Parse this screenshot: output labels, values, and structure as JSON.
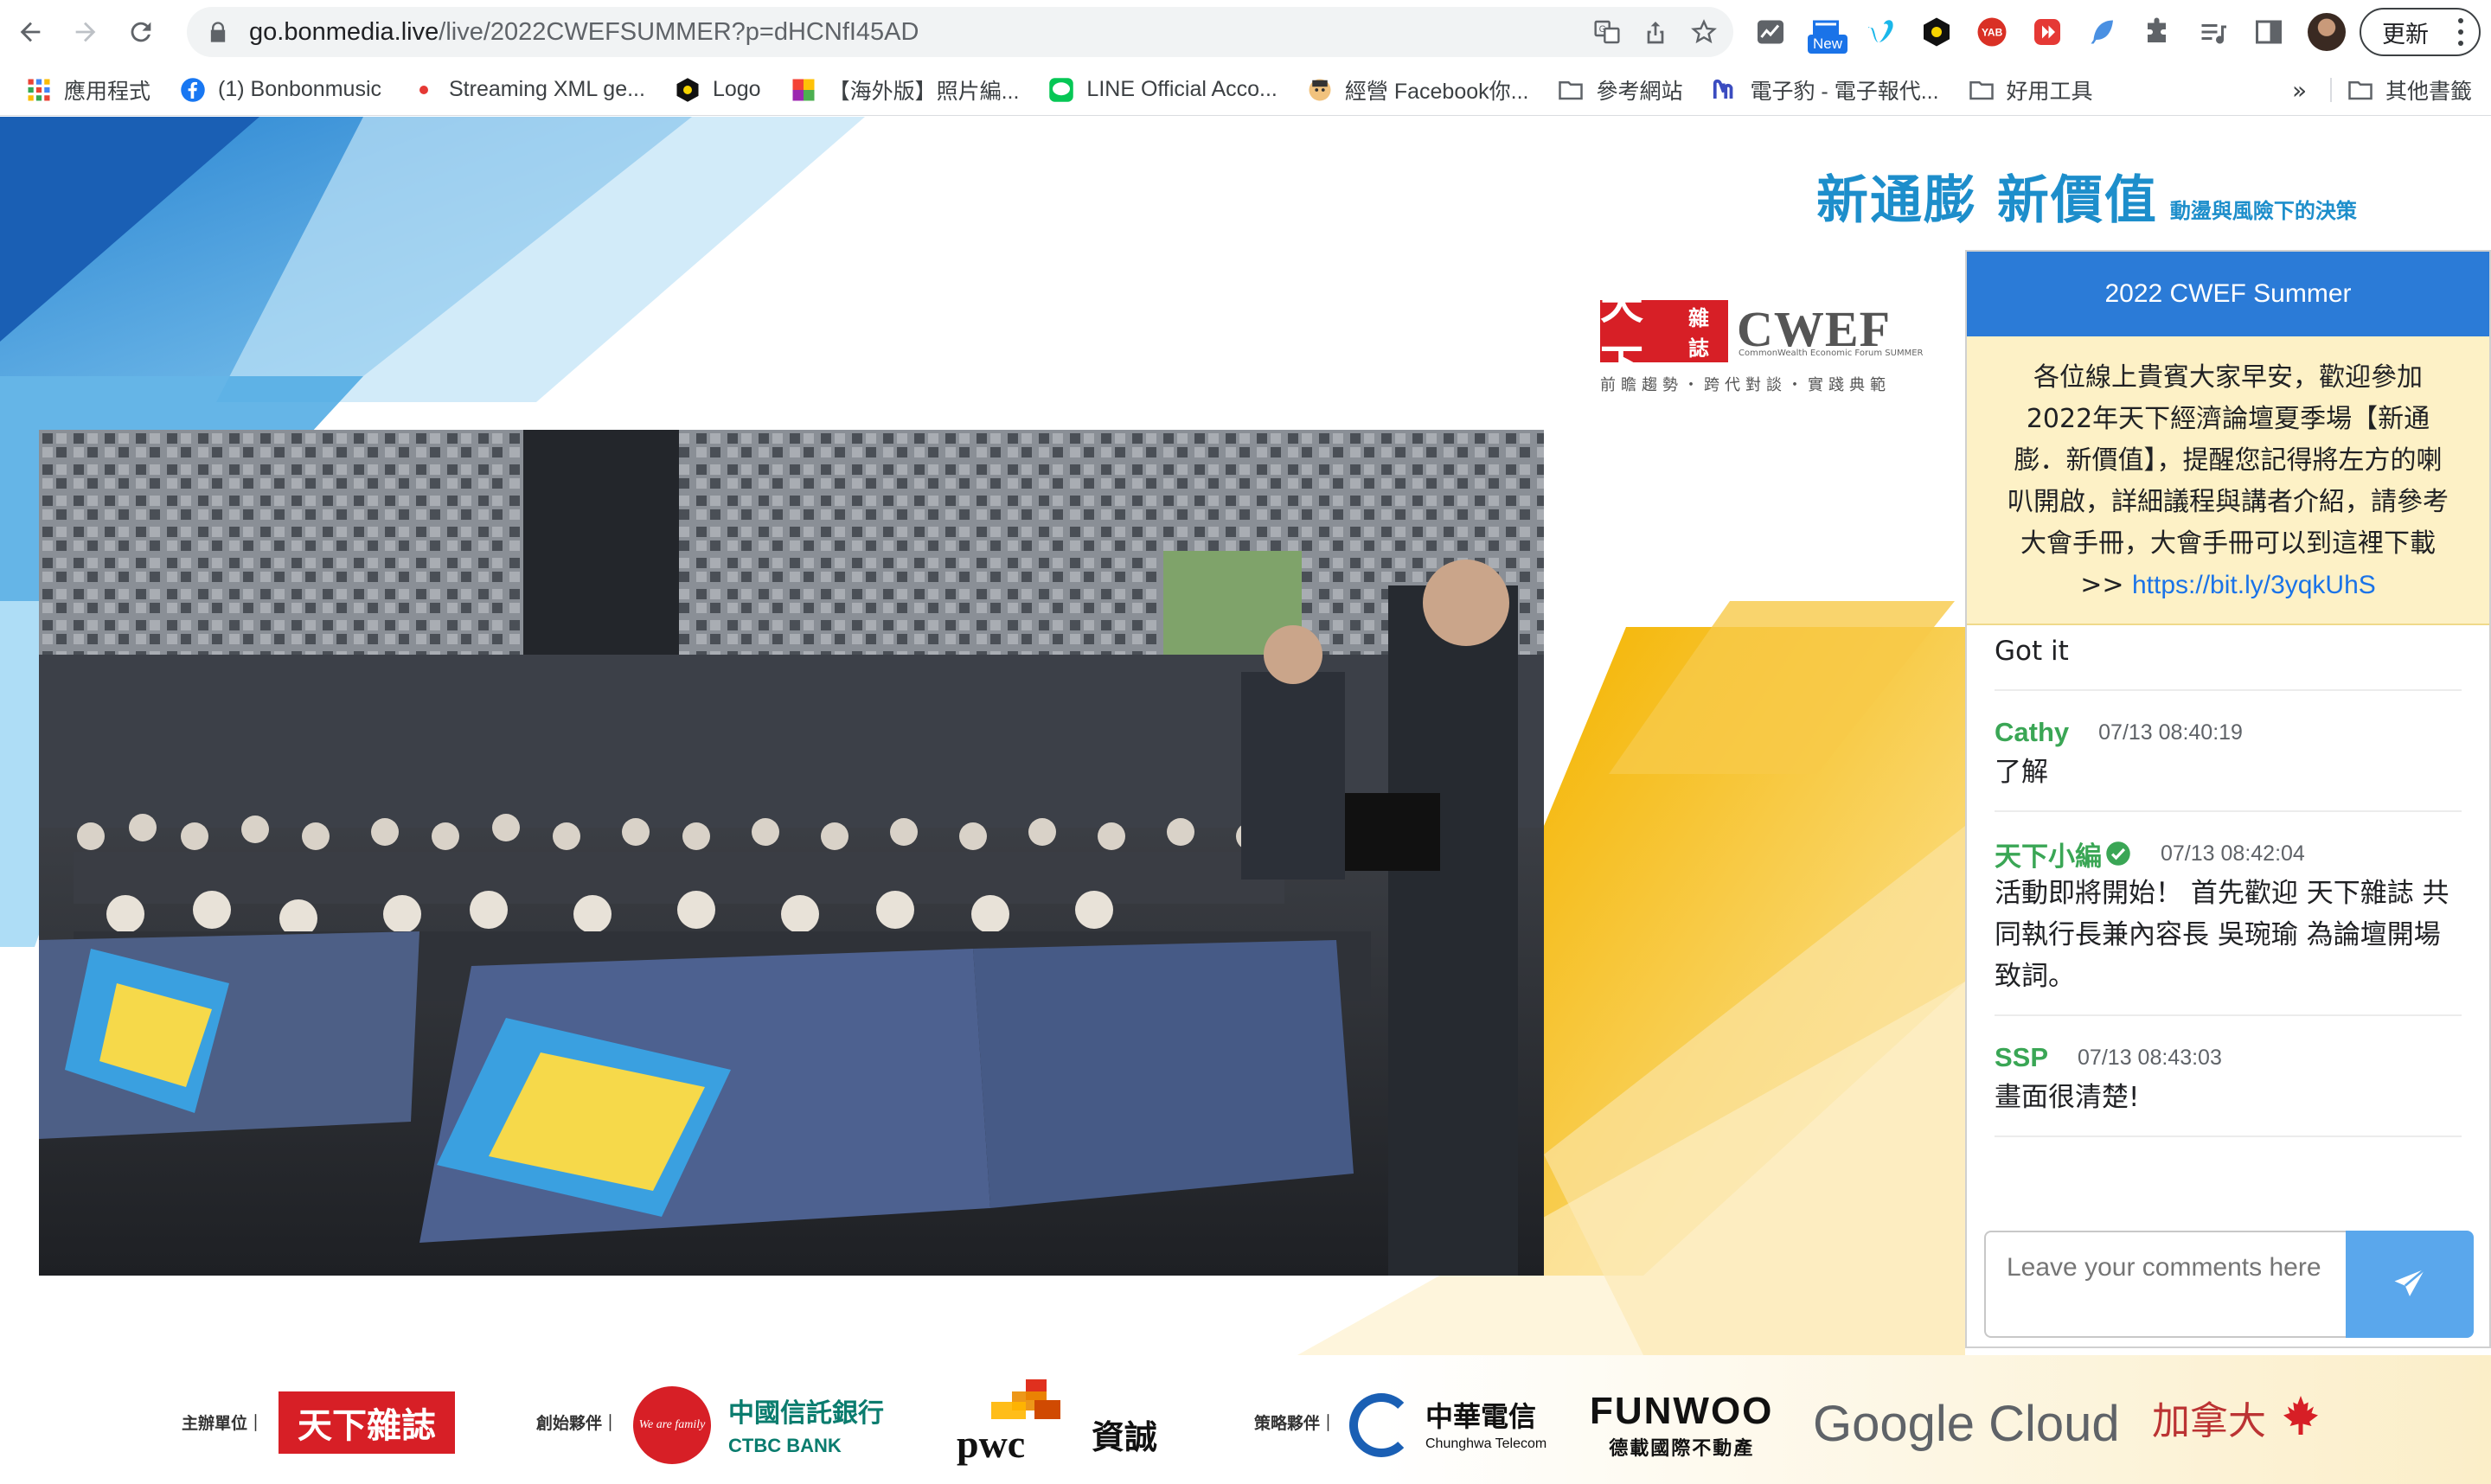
{
  "browser": {
    "url_host": "go.bonmedia.live",
    "url_path": "/live/2022CWEFSUMMER?p=dHCNfI45AD",
    "update_label": "更新",
    "new_badge": "New",
    "bookmarks": [
      {
        "label": "應用程式"
      },
      {
        "label": "(1) Bonbonmusic"
      },
      {
        "label": "Streaming XML ge..."
      },
      {
        "label": "Logo"
      },
      {
        "label": "【海外版】照片編..."
      },
      {
        "label": "LINE Official Acco..."
      },
      {
        "label": "經營 Facebook你..."
      },
      {
        "label": "參考網站"
      },
      {
        "label": "電子豹 - 電子報代..."
      },
      {
        "label": "好用工具"
      }
    ],
    "overflow": "»",
    "other_bookmarks": "其他書籤"
  },
  "page": {
    "headline": "新通膨 新價值",
    "headline_sub": "動盪與風險下的決策",
    "logo_mark_text": "天下",
    "logo_mark_small": "雜誌",
    "logo_cwef": "CWEF",
    "logo_cwef_sub": "CommonWealth Economic Forum SUMMER",
    "logo_tagline": "前瞻趨勢・跨代對談・實踐典範"
  },
  "chat": {
    "title": "2022 CWEF Summer",
    "announcement": "各位線上貴賓大家早安，歡迎參加2022年天下經濟論壇夏季場【新通膨．新價值】，提醒您記得將左方的喇叭開啟，詳細議程與講者介紹，請參考大會手冊，大會手冊可以到這裡下載>> ",
    "announcement_link": "https://bit.ly/3yqkUhS",
    "messages": [
      {
        "name": "",
        "time": "",
        "text": "Got it"
      },
      {
        "name": "Cathy",
        "time": "07/13 08:40:19",
        "text": "了解"
      },
      {
        "name": "天下小編",
        "time": "07/13 08:42:04",
        "text": "活動即將開始！ 首先歡迎 天下雜誌 共同執行長兼內容長 吳琬瑜 為論壇開場致詞。"
      },
      {
        "name": "SSP",
        "time": "07/13 08:43:03",
        "text": "畫面很清楚!"
      }
    ],
    "input_placeholder": "Leave your comments here"
  },
  "sponsors": {
    "organizer_label": "主辦單位｜",
    "founding_label": "創始夥伴｜",
    "strategic_label": "策略夥伴｜",
    "logos": {
      "cw": "天下雜誌",
      "ctbc_cn": "中國信託銀行",
      "ctbc_en": "CTBC BANK",
      "ctbc_badge": "We are family",
      "pwc": "pwc",
      "pwc_cn": "資誠",
      "cht_cn": "中華電信",
      "cht_en": "Chunghwa Telecom",
      "funwoo": "FUNWOO",
      "funwoo_cn": "德載國際不動產",
      "google": "Google Cloud",
      "canada": "加拿大"
    }
  },
  "colors": {
    "chat_header": "#2b7bd7",
    "announcement_bg": "#fdf1c6",
    "username": "#3aa655",
    "send_button": "#5aa7ec",
    "brand_blue": "#1d8ecb",
    "brand_red": "#d71f26"
  }
}
